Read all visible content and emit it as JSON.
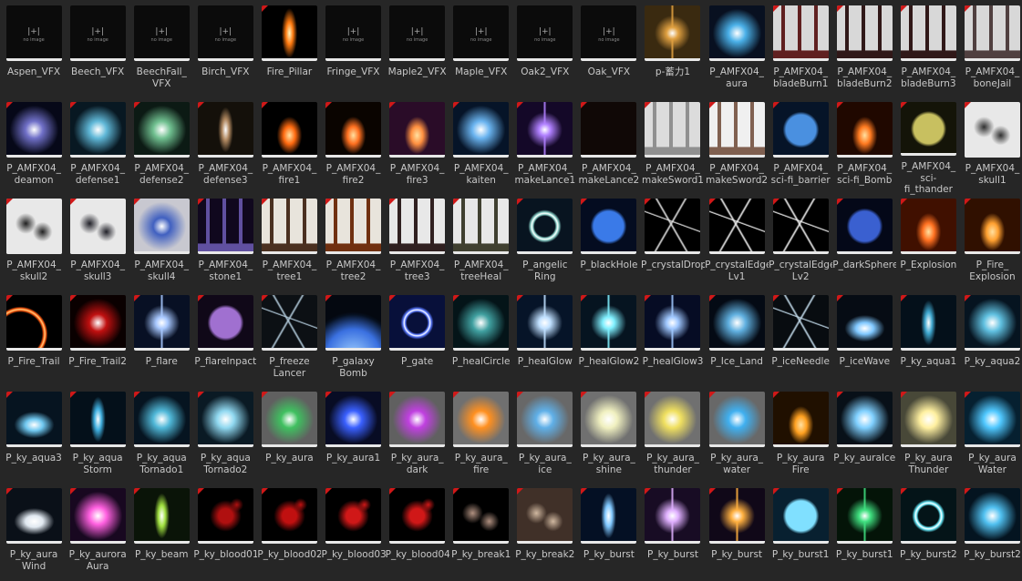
{
  "colors": {
    "background": "#262626",
    "label": "#c8c8c8",
    "bar": "#e8e8e8",
    "flag": "#d01818"
  },
  "assets": [
    {
      "label": "Aspen_VFX",
      "thumb": "placeholder"
    },
    {
      "label": "Beech_VFX",
      "thumb": "placeholder"
    },
    {
      "label": "BeechFall_\nVFX",
      "thumb": "placeholder"
    },
    {
      "label": "Birch_VFX",
      "thumb": "placeholder"
    },
    {
      "label": "Fire_Pillar",
      "thumb": "fire-pillar",
      "bg": "#000",
      "color": "#ff7a10",
      "flag": true
    },
    {
      "label": "Fringe_VFX",
      "thumb": "placeholder"
    },
    {
      "label": "Maple2_VFX",
      "thumb": "placeholder"
    },
    {
      "label": "Maple_VFX",
      "thumb": "placeholder"
    },
    {
      "label": "Oak2_VFX",
      "thumb": "placeholder"
    },
    {
      "label": "Oak_VFX",
      "thumb": "placeholder"
    },
    {
      "label": "p-蓄力1",
      "thumb": "burst",
      "bg": "#3a2a10",
      "color": "#e0a040"
    },
    {
      "label": "P_AMFX04_\naura",
      "thumb": "glow",
      "bg": "#081020",
      "color": "#4ab0e8"
    },
    {
      "label": "P_AMFX04_\nbladeBurn1",
      "thumb": "spikes",
      "bg": "#d8d8d8",
      "color": "#602020",
      "flag": true
    },
    {
      "label": "P_AMFX04_\nbladeBurn2",
      "thumb": "spikes",
      "bg": "#d8d8d8",
      "color": "#301818",
      "flag": true
    },
    {
      "label": "P_AMFX04_\nbladeBurn3",
      "thumb": "spikes",
      "bg": "#d8d8d8",
      "color": "#301818",
      "flag": true
    },
    {
      "label": "P_AMFX04_\nboneJail",
      "thumb": "spikes",
      "bg": "#d8d8d8",
      "color": "#504040",
      "flag": true
    },
    {
      "label": "P_AMFX04_\ndeamon",
      "thumb": "glow",
      "bg": "#060818",
      "color": "#7070c8",
      "flag": true
    },
    {
      "label": "P_AMFX04_\ndefense1",
      "thumb": "glow",
      "bg": "#081822",
      "color": "#60b8d8",
      "flag": true
    },
    {
      "label": "P_AMFX04_\ndefense2",
      "thumb": "glow",
      "bg": "#0c1a14",
      "color": "#70c090",
      "flag": true
    },
    {
      "label": "P_AMFX04_\ndefense3",
      "thumb": "pillar",
      "bg": "#14100a",
      "color": "#b08860",
      "flag": true
    },
    {
      "label": "P_AMFX04_\nfire1",
      "thumb": "fire",
      "bg": "#000",
      "color": "#ff6a10",
      "flag": true
    },
    {
      "label": "P_AMFX04_\nfire2",
      "thumb": "fire",
      "bg": "#0a0400",
      "color": "#ff7020",
      "flag": true
    },
    {
      "label": "P_AMFX04_\nfire3",
      "thumb": "fire",
      "bg": "#2a0c28",
      "color": "#ff9040",
      "flag": true
    },
    {
      "label": "P_AMFX04_\nkaiten",
      "thumb": "glow",
      "bg": "#061428",
      "color": "#6ab4f0",
      "flag": true
    },
    {
      "label": "P_AMFX04_\nmakeLance1",
      "thumb": "burst",
      "bg": "#140828",
      "color": "#b080ff",
      "flag": true
    },
    {
      "label": "P_AMFX04_\nmakeLance2",
      "thumb": "sparks",
      "bg": "#100806",
      "color": "#d09060",
      "flag": true
    },
    {
      "label": "P_AMFX04_\nmakeSword1",
      "thumb": "spikes",
      "bg": "#dcdcdc",
      "color": "#909090",
      "flag": true
    },
    {
      "label": "P_AMFX04_\nmakeSword2",
      "thumb": "spikes",
      "bg": "#f0f0f0",
      "color": "#806050",
      "flag": true
    },
    {
      "label": "P_AMFX04_\nsci-fi_barrier",
      "thumb": "sphere",
      "bg": "#061428",
      "color": "#4a90e0",
      "flag": true
    },
    {
      "label": "P_AMFX04_\nsci-fi_Bomb",
      "thumb": "fire",
      "bg": "#200800",
      "color": "#ff7a20",
      "flag": true
    },
    {
      "label": "P_AMFX04_\nsci-fi_thander",
      "thumb": "sphere",
      "bg": "#141408",
      "color": "#c8c060",
      "flag": true
    },
    {
      "label": "P_AMFX04_\nskull1",
      "thumb": "smoke",
      "bg": "#e8e8e8",
      "color": "#303030",
      "flag": true
    },
    {
      "label": "P_AMFX04_\nskull2",
      "thumb": "smoke",
      "bg": "#e8e8e8",
      "color": "#202020",
      "flag": true
    },
    {
      "label": "P_AMFX04_\nskull3",
      "thumb": "smoke",
      "bg": "#e8e8e8",
      "color": "#202028",
      "flag": true
    },
    {
      "label": "P_AMFX04_\nskull4",
      "thumb": "glow",
      "bg": "#c8c8d0",
      "color": "#4060c0",
      "flag": true
    },
    {
      "label": "P_AMFX04_\nstone1",
      "thumb": "spikes",
      "bg": "#10081e",
      "color": "#6050a0",
      "flag": true
    },
    {
      "label": "P_AMFX04_\ntree1",
      "thumb": "spikes",
      "bg": "#e8e4dc",
      "color": "#4a3020",
      "flag": true
    },
    {
      "label": "P_AMFX04_\ntree2",
      "thumb": "spikes",
      "bg": "#e8e4dc",
      "color": "#703010",
      "flag": true
    },
    {
      "label": "P_AMFX04_\ntree3",
      "thumb": "spikes",
      "bg": "#e8e8e8",
      "color": "#302020",
      "flag": true
    },
    {
      "label": "P_AMFX04_\ntreeHeal",
      "thumb": "spikes",
      "bg": "#e8e8e8",
      "color": "#404030",
      "flag": true
    },
    {
      "label": "P_angelic\nRing",
      "thumb": "ring",
      "bg": "#081420",
      "color": "#8ad0c8",
      "flag": true
    },
    {
      "label": "P_blackHole",
      "thumb": "sphere",
      "bg": "#040c20",
      "color": "#3a7ae8",
      "flag": true
    },
    {
      "label": "P_crystalDrop",
      "thumb": "crack",
      "bg": "#000",
      "color": "#e0e0e0",
      "flag": true
    },
    {
      "label": "P_crystalEdge\nLv1",
      "thumb": "crack",
      "bg": "#000",
      "color": "#f0f0f0",
      "flag": true
    },
    {
      "label": "P_crystalEdge\nLv2",
      "thumb": "crack",
      "bg": "#000",
      "color": "#f0f0f0",
      "flag": true
    },
    {
      "label": "P_darkSphere",
      "thumb": "sphere",
      "bg": "#040818",
      "color": "#3a60d0",
      "flag": true
    },
    {
      "label": "P_Explosion",
      "thumb": "fire",
      "bg": "#401000",
      "color": "#ff7020",
      "flag": true
    },
    {
      "label": "P_Fire_\nExplosion",
      "thumb": "fire",
      "bg": "#301000",
      "color": "#ffa030",
      "flag": true
    },
    {
      "label": "P_Fire_Trail",
      "thumb": "arc",
      "bg": "#000",
      "color": "#ff5a10",
      "flag": true
    },
    {
      "label": "P_Fire_Trail2",
      "thumb": "glow",
      "bg": "#0a0000",
      "color": "#c01010",
      "flag": true
    },
    {
      "label": "P_flare",
      "thumb": "burst",
      "bg": "#081024",
      "color": "#a8c8ff",
      "flag": true
    },
    {
      "label": "P_flareInpact",
      "thumb": "sphere",
      "bg": "#100818",
      "color": "#a070d0",
      "flag": true
    },
    {
      "label": "P_freeze\nLancer",
      "thumb": "crack",
      "bg": "#0c1014",
      "color": "#b0c8d8",
      "flag": true
    },
    {
      "label": "P_galaxy\nBomb",
      "thumb": "planet",
      "bg": "#040810",
      "color": "#3a70e0",
      "flag": true
    },
    {
      "label": "P_gate",
      "thumb": "ring",
      "bg": "#08103a",
      "color": "#5a7aff",
      "flag": true
    },
    {
      "label": "P_healCircle",
      "thumb": "glow",
      "bg": "#041418",
      "color": "#40a0a0",
      "flag": true
    },
    {
      "label": "P_healGlow",
      "thumb": "burst",
      "bg": "#061428",
      "color": "#c0e0ff",
      "flag": true
    },
    {
      "label": "P_healGlow2",
      "thumb": "burst",
      "bg": "#061420",
      "color": "#80f0ff",
      "flag": true
    },
    {
      "label": "P_healGlow3",
      "thumb": "burst",
      "bg": "#060c24",
      "color": "#a0c8ff",
      "flag": true
    },
    {
      "label": "P_Ice_Land",
      "thumb": "glow",
      "bg": "#040a14",
      "color": "#60b0e0",
      "flag": true
    },
    {
      "label": "P_iceNeedle",
      "thumb": "crack",
      "bg": "#080c10",
      "color": "#c0d8e8",
      "flag": true
    },
    {
      "label": "P_iceWave",
      "thumb": "wave",
      "bg": "#060c14",
      "color": "#80c8ff",
      "flag": true
    },
    {
      "label": "P_ky_aqua1",
      "thumb": "pillar",
      "bg": "#04101a",
      "color": "#40a8d0",
      "flag": true
    },
    {
      "label": "P_ky_aqua2",
      "thumb": "glow",
      "bg": "#061420",
      "color": "#60c0e0",
      "flag": true
    },
    {
      "label": "P_ky_aqua3",
      "thumb": "wave",
      "bg": "#061420",
      "color": "#70c8f0",
      "flag": true
    },
    {
      "label": "P_ky_aqua\nStorm",
      "thumb": "pillar",
      "bg": "#04101a",
      "color": "#40b0e0",
      "flag": true
    },
    {
      "label": "P_ky_aqua\nTornado1",
      "thumb": "glow",
      "bg": "#061420",
      "color": "#50b8d8",
      "flag": true
    },
    {
      "label": "P_ky_aqua\nTornado2",
      "thumb": "glow",
      "bg": "#0a1a24",
      "color": "#90d8f0",
      "flag": true
    },
    {
      "label": "P_ky_aura",
      "thumb": "glow",
      "bg": "#606060",
      "color": "#40c060",
      "flag": true
    },
    {
      "label": "P_ky_aura1",
      "thumb": "glow",
      "bg": "#080c24",
      "color": "#3a60ff",
      "flag": true
    },
    {
      "label": "P_ky_aura_\ndark",
      "thumb": "glow",
      "bg": "#606060",
      "color": "#c040e0",
      "flag": true
    },
    {
      "label": "P_ky_aura_\nfire",
      "thumb": "glow",
      "bg": "#707070",
      "color": "#ff9020",
      "flag": true
    },
    {
      "label": "P_ky_aura_\nice",
      "thumb": "glow",
      "bg": "#686868",
      "color": "#60b0e8",
      "flag": true
    },
    {
      "label": "P_ky_aura_\nshine",
      "thumb": "glow",
      "bg": "#707070",
      "color": "#f0f0c0",
      "flag": true
    },
    {
      "label": "P_ky_aura_\nthunder",
      "thumb": "glow",
      "bg": "#707070",
      "color": "#f0e060",
      "flag": true
    },
    {
      "label": "P_ky_aura_\nwater",
      "thumb": "glow",
      "bg": "#686868",
      "color": "#40b0f0",
      "flag": true
    },
    {
      "label": "P_ky_aura\nFire",
      "thumb": "fire",
      "bg": "#201000",
      "color": "#ffa020",
      "flag": true
    },
    {
      "label": "P_ky_auraIce",
      "thumb": "glow",
      "bg": "#081018",
      "color": "#80d0ff",
      "flag": true
    },
    {
      "label": "P_ky_aura\nThunder",
      "thumb": "glow",
      "bg": "#484838",
      "color": "#fff0a0",
      "flag": true
    },
    {
      "label": "P_ky_aura\nWater",
      "thumb": "glow",
      "bg": "#062030",
      "color": "#50c8ff",
      "flag": true
    },
    {
      "label": "P_ky_aura\nWind",
      "thumb": "wave",
      "bg": "#0a1018",
      "color": "#e0e8f0",
      "flag": true
    },
    {
      "label": "P_ky_aurora\nAura",
      "thumb": "glow",
      "bg": "#180820",
      "color": "#ff60e0",
      "flag": true
    },
    {
      "label": "P_ky_beam",
      "thumb": "pillar",
      "bg": "#0a1408",
      "color": "#a0e040",
      "flag": true
    },
    {
      "label": "P_ky_blood01",
      "thumb": "blood",
      "bg": "#000",
      "color": "#b01010",
      "flag": true
    },
    {
      "label": "P_ky_blood02",
      "thumb": "blood",
      "bg": "#000",
      "color": "#c01010",
      "flag": true
    },
    {
      "label": "P_ky_blood03",
      "thumb": "blood",
      "bg": "#000",
      "color": "#d01818",
      "flag": true
    },
    {
      "label": "P_ky_blood04",
      "thumb": "blood",
      "bg": "#000",
      "color": "#d01818",
      "flag": true
    },
    {
      "label": "P_ky_break1",
      "thumb": "smoke",
      "bg": "#000",
      "color": "#b09080",
      "flag": true
    },
    {
      "label": "P_ky_break2",
      "thumb": "smoke",
      "bg": "#403028",
      "color": "#d0b8a0",
      "flag": true
    },
    {
      "label": "P_ky_burst",
      "thumb": "pillar",
      "bg": "#041024",
      "color": "#80c8ff",
      "flag": true
    },
    {
      "label": "P_ky_burst",
      "thumb": "burst",
      "bg": "#180c24",
      "color": "#e0b0ff",
      "flag": true
    },
    {
      "label": "P_ky_burst",
      "thumb": "burst",
      "bg": "#100818",
      "color": "#ffb040",
      "flag": true
    },
    {
      "label": "P_ky_burst1",
      "thumb": "sphere",
      "bg": "#082030",
      "color": "#80e0ff",
      "flag": true
    },
    {
      "label": "P_ky_burst1",
      "thumb": "burst",
      "bg": "#041408",
      "color": "#40e080",
      "flag": true
    },
    {
      "label": "P_ky_burst2",
      "thumb": "ring",
      "bg": "#041418",
      "color": "#60e0f0",
      "flag": true
    },
    {
      "label": "P_ky_burst2",
      "thumb": "glow",
      "bg": "#041420",
      "color": "#50c0f0",
      "flag": true
    }
  ]
}
